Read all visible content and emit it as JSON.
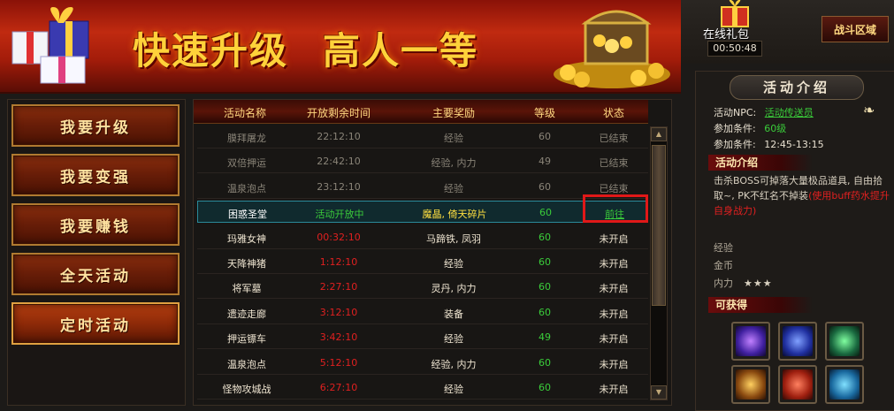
{
  "banner": {
    "title_left": "快速升级",
    "title_right": "高人一等"
  },
  "nav": {
    "items": [
      {
        "label": "我要升级"
      },
      {
        "label": "我要变强"
      },
      {
        "label": "我要赚钱"
      },
      {
        "label": "全天活动"
      },
      {
        "label": "定时活动"
      }
    ],
    "active_index": 4
  },
  "table": {
    "headers": [
      "活动名称",
      "开放剩余时间",
      "主要奖励",
      "等级",
      "状态"
    ],
    "rows": [
      {
        "name": "膜拜屠龙",
        "time": "22:12:10",
        "reward": "经验",
        "level": "60",
        "status": "已结束",
        "state": "ended"
      },
      {
        "name": "双倍押运",
        "time": "22:42:10",
        "reward": "经验, 内力",
        "level": "49",
        "status": "已结束",
        "state": "ended"
      },
      {
        "name": "温泉泡点",
        "time": "23:12:10",
        "reward": "经验",
        "level": "60",
        "status": "已结束",
        "state": "ended"
      },
      {
        "name": "困惑圣堂",
        "time": "活动开放中",
        "reward": "魔晶, 倚天碎片",
        "level": "60",
        "status": "前往",
        "state": "active"
      },
      {
        "name": "玛雅女神",
        "time": "00:32:10",
        "reward": "马蹄铁, 凤羽",
        "level": "60",
        "status": "未开启",
        "state": "pending"
      },
      {
        "name": "天降神猪",
        "time": "1:12:10",
        "reward": "经验",
        "level": "60",
        "status": "未开启",
        "state": "pending"
      },
      {
        "name": "将军墓",
        "time": "2:27:10",
        "reward": "灵丹, 内力",
        "level": "60",
        "status": "未开启",
        "state": "pending"
      },
      {
        "name": "遗迹走廊",
        "time": "3:12:10",
        "reward": "装备",
        "level": "60",
        "status": "未开启",
        "state": "pending"
      },
      {
        "name": "押运镖车",
        "time": "3:42:10",
        "reward": "经验",
        "level": "49",
        "status": "未开启",
        "state": "pending"
      },
      {
        "name": "温泉泡点",
        "time": "5:12:10",
        "reward": "经验, 内力",
        "level": "60",
        "status": "未开启",
        "state": "pending"
      },
      {
        "name": "怪物攻城战",
        "time": "6:27:10",
        "reward": "经验",
        "level": "60",
        "status": "未开启",
        "state": "pending"
      }
    ]
  },
  "top_right": {
    "online_label": "在线礼包",
    "online_timer": "00:50:48",
    "battle_button": "战斗区域"
  },
  "info": {
    "title": "活动介绍",
    "npc_label": "活动NPC:",
    "npc_value": "活动传送员",
    "cond1_label": "参加条件:",
    "cond1_value": "60级",
    "cond2_label": "参加条件:",
    "cond2_value": "12:45-13:15",
    "intro_tab": "活动介绍",
    "desc_main": "击杀BOSS可掉落大量极品道具, 自由拾取~, PK不红名不掉装",
    "desc_red": "(使用buff药水提升自身战力)",
    "reward_exp": "经验",
    "reward_gold": "金币",
    "reward_power": "内力",
    "reward_power_stars": "★★★",
    "obtain_tab": "可获得"
  },
  "colors": {
    "active_green": "#3acc3a",
    "countdown_red": "#e02020",
    "highlight_red": "#e01818",
    "gold_text": "#ffd880"
  }
}
